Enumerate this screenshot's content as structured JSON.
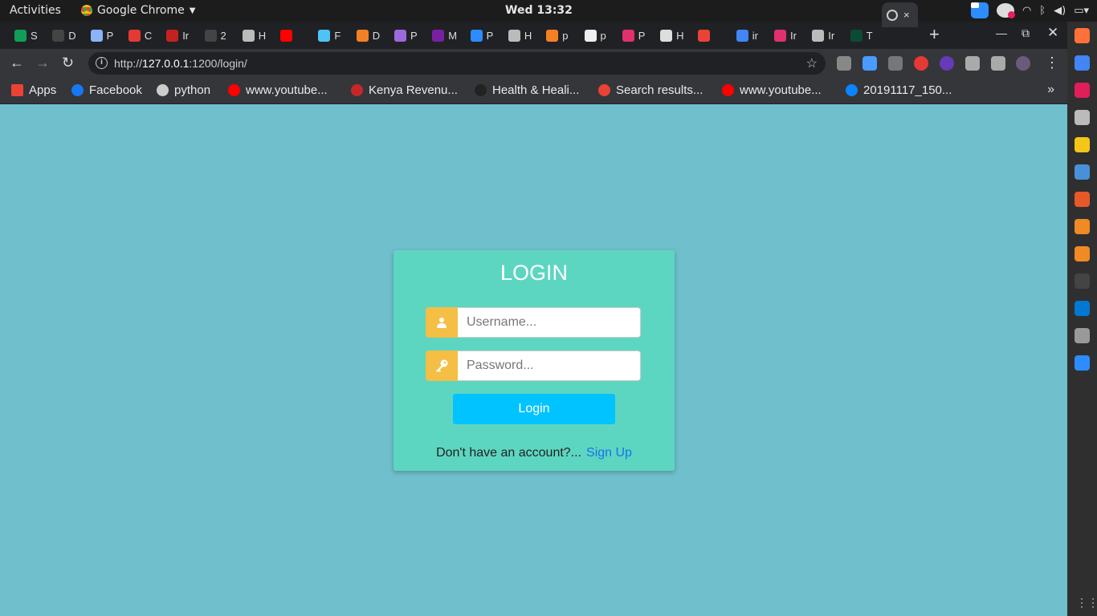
{
  "os": {
    "activities": "Activities",
    "app_name": "Google Chrome",
    "clock": "Wed 13:32"
  },
  "tabs": [
    {
      "label": "S",
      "color": "#0f9d58"
    },
    {
      "label": "D",
      "color": "#444"
    },
    {
      "label": "P",
      "color": "#8ab4f8"
    },
    {
      "label": "C",
      "color": "#e53935"
    },
    {
      "label": "Ir",
      "color": "#c5221f"
    },
    {
      "label": "2",
      "color": "#444"
    },
    {
      "label": "H",
      "color": "#bbb"
    },
    {
      "label": "",
      "color": "#ff0000"
    },
    {
      "label": "F",
      "color": "#4fc3f7"
    },
    {
      "label": "D",
      "color": "#f48024"
    },
    {
      "label": "P",
      "color": "#9c6ade"
    },
    {
      "label": "M",
      "color": "#7b1fa2"
    },
    {
      "label": "P",
      "color": "#2d8cff"
    },
    {
      "label": "H",
      "color": "#bbb"
    },
    {
      "label": "p",
      "color": "#f48024"
    },
    {
      "label": "p",
      "color": "#eee"
    },
    {
      "label": "P",
      "color": "#e1306c"
    },
    {
      "label": "H",
      "color": "#ddd"
    },
    {
      "label": "",
      "color": "#ea4335"
    },
    {
      "label": "ir",
      "color": "#4285f4"
    },
    {
      "label": "Ir",
      "color": "#e1306c"
    },
    {
      "label": "Ir",
      "color": "#bbb"
    },
    {
      "label": "T",
      "color": "#0c4b33"
    }
  ],
  "active_tab_close": "×",
  "toolbar": {
    "url_prefix": "http://",
    "url_host": "127.0.0.1",
    "url_rest": ":1200/login/"
  },
  "bookmarks": [
    {
      "label": "Apps",
      "icon": "apps-grid-icon",
      "color": "#ea4335"
    },
    {
      "label": "Facebook",
      "icon": "facebook-icon",
      "color": "#1877f2"
    },
    {
      "label": "python",
      "icon": "globe-icon",
      "color": "#ccc"
    },
    {
      "label": "www.youtube...",
      "icon": "youtube-icon",
      "color": "#ff0000"
    },
    {
      "label": "Kenya Revenu...",
      "icon": "kra-icon",
      "color": "#c62828"
    },
    {
      "label": "Health & Heali...",
      "icon": "jp-icon",
      "color": "#222"
    },
    {
      "label": "Search results...",
      "icon": "gmail-icon",
      "color": "#ea4335"
    },
    {
      "label": "www.youtube...",
      "icon": "youtube-icon",
      "color": "#ff0000"
    },
    {
      "label": "20191117_150...",
      "icon": "onedrive-icon",
      "color": "#0a84ff"
    }
  ],
  "login": {
    "title": "LOGIN",
    "username_placeholder": "Username...",
    "password_placeholder": "Password...",
    "button": "Login",
    "signup_prompt": "Don't have an account?...",
    "signup_link": "Sign Up"
  },
  "colors": {
    "page_bg": "#6fbfcc",
    "card_bg": "#5dd6c1",
    "addon": "#f5be45",
    "button": "#00c3ff",
    "link": "#1a73e8"
  }
}
